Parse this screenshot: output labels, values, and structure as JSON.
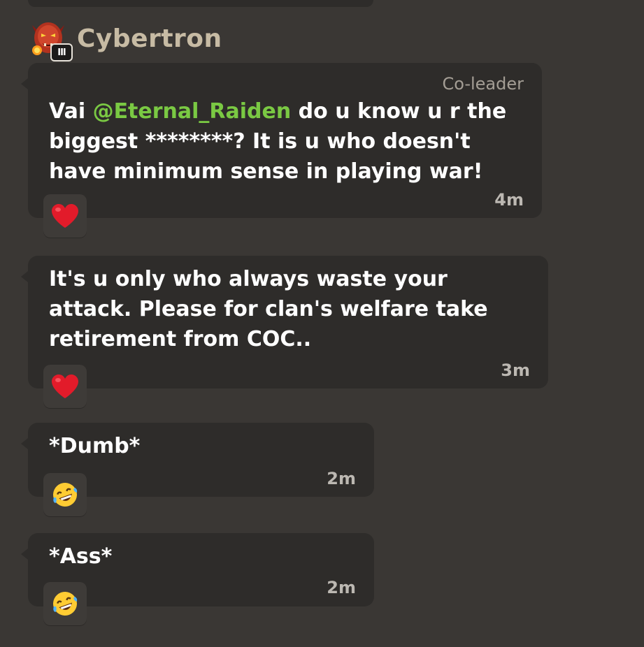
{
  "author": {
    "name": "Cybertron",
    "badge_text": "III",
    "role": "Co-leader"
  },
  "messages": [
    {
      "text_before": "Vai ",
      "mention": "@Eternal_Raiden",
      "text_after": " do u know u r the\nbiggest ********? It is u who doesn't\nhave minimum sense in playing war!",
      "time": "4m",
      "reaction": "heart-icon"
    },
    {
      "text": "It's u only who always waste your\nattack. Please for clan's welfare take\nretirement from COC..",
      "time": "3m",
      "reaction": "heart-icon"
    },
    {
      "text": "*Dumb*",
      "time": "2m",
      "reaction": "laughing-emoji-icon"
    },
    {
      "text": "*Ass*",
      "time": "2m",
      "reaction": "laughing-emoji-icon"
    }
  ],
  "colors": {
    "background": "#3a3734",
    "bubble": "#2e2c2a",
    "author_name": "#c7bba4",
    "mention": "#7ac943",
    "role": "#a49e95",
    "time": "#bcb8b2",
    "heart": "#e21b2a"
  }
}
